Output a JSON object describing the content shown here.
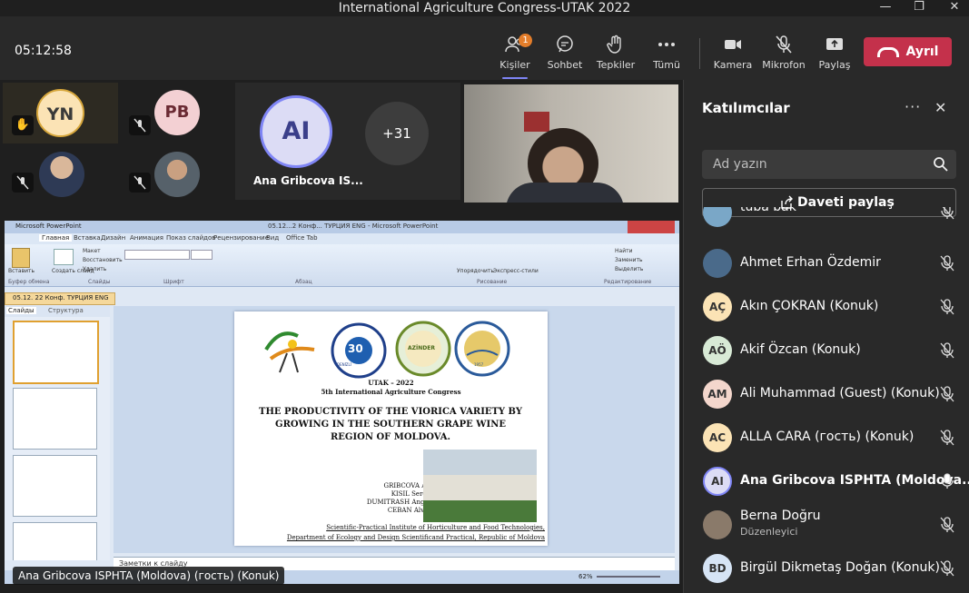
{
  "window": {
    "title": "International Agriculture Congress-UTAK 2022"
  },
  "toolbar": {
    "timer": "05:12:58",
    "people_label": "Kişiler",
    "people_badge": "1",
    "chat_label": "Sohbet",
    "reactions_label": "Tepkiler",
    "more_label": "Tümü",
    "camera_label": "Kamera",
    "mic_label": "Mikrofon",
    "share_label": "Paylaş",
    "leave_label": "Ayrıl"
  },
  "stage": {
    "tiles": [
      {
        "initials": "YN"
      },
      {
        "initials": "PB"
      },
      {
        "initials": "AI",
        "name": "Ana Gribcova IS..."
      },
      {
        "overflow": "+31"
      }
    ],
    "presenter_name": "Ana Gribcova ISPHTA (Moldova) (гость) (Konuk)"
  },
  "ppt": {
    "app_title": "Microsoft PowerPoint",
    "window_title": "05.12...2 Конф... ТУРЦИЯ ENG - Microsoft PowerPoint",
    "tabs": [
      "Главная",
      "Вставка",
      "Дизайн",
      "Анимация",
      "Показ слайдов",
      "Рецензирование",
      "Вид",
      "Office Tab"
    ],
    "doc_tab": "05.12. 22 Конф. ТУРЦИЯ ENG",
    "panel_tabs": [
      "Слайды",
      "Структура"
    ],
    "notes_placeholder": "Заметки к слайду",
    "zoom": "62%",
    "ribbon_groups": [
      "Буфер обмена",
      "Слайды",
      "Шрифт",
      "Абзац",
      "Рисование",
      "Редактирование"
    ],
    "ribbon_buttons": {
      "paste": "Вставить",
      "new_slide": "Создать слайд",
      "layout": "Макет",
      "reset": "Восстановить",
      "delete": "Удалить",
      "arrange": "Упорядочить",
      "quick_styles": "Экспресс-стили",
      "find": "Найти",
      "replace": "Заменить",
      "select": "Выделить"
    }
  },
  "slide": {
    "heading1": "UTAK – 2022",
    "heading2": "5th International Agriculture Congress",
    "title": "THE PRODUCTIVITY OF THE VIORICA VARIETY BY GROWING IN THE SOUTHERN GRAPE WINE REGION OF MOLDOVA.",
    "authors": [
      "GRIBCOVA Ana",
      "KISIL Sergey",
      "DUMITRASH Angela",
      "CEBAN Alvina"
    ],
    "institute": "Scientific-Practical Institute of Horticulture and Food Technologies,",
    "department": "Department of Ecology and Design Scientificand Practical, Republic of Moldova",
    "logo_labels": [
      "PAMUKKALE ÜNİVERSİTESİ",
      "30",
      "DENİZLİ",
      "AZİNDER",
      "ATATÜRK ÜNİVERSİTESİ",
      "1957"
    ]
  },
  "panel": {
    "title": "Katılımcılar",
    "search_placeholder": "Ad yazın",
    "share_invite": "Daveti paylaş",
    "participants": [
      {
        "name": "tuba bak",
        "initials": "",
        "avatar_color": "#7aa7c7",
        "mic": "off"
      },
      {
        "name": "Ahmet Erhan Özdemir",
        "initials": "",
        "avatar_color": "#4a6a8a",
        "mic": "off"
      },
      {
        "name": "Akın ÇOKRAN (Konuk)",
        "initials": "AÇ",
        "avatar_color": "#fbe3b5",
        "mic": "off"
      },
      {
        "name": "Akif Özcan (Konuk)",
        "initials": "AÖ",
        "avatar_color": "#d8ead6",
        "mic": "off"
      },
      {
        "name": "Ali Muhammad (Guest) (Konuk)",
        "initials": "AM",
        "avatar_color": "#f3d6cc",
        "mic": "off"
      },
      {
        "name": "ALLA CARA (гость) (Konuk)",
        "initials": "AC",
        "avatar_color": "#fbe3b5",
        "mic": "off"
      },
      {
        "name": "Ana Gribcova ISPHTA (Moldova...",
        "initials": "AI",
        "avatar_color": "#dcdcf5",
        "mic": "on"
      },
      {
        "name": "Berna Doğru",
        "role": "Düzenleyici",
        "initials": "",
        "avatar_color": "#8a7a6a",
        "mic": "off"
      },
      {
        "name": "Birgül Dikmetaş Doğan (Konuk)",
        "initials": "BD",
        "avatar_color": "#d6e4f5",
        "mic": "off"
      }
    ]
  },
  "colors": {
    "accent": "#7f85f5",
    "leave": "#c4314b",
    "badge": "#e37d2a"
  }
}
